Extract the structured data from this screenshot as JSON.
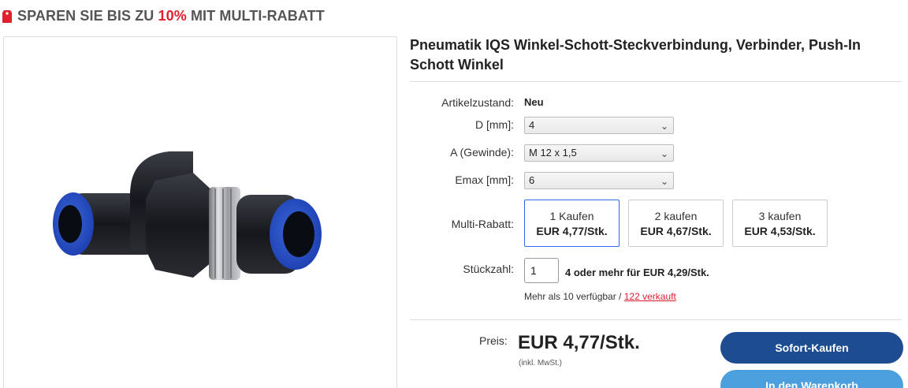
{
  "banner": {
    "prefix": "SPAREN SIE BIS ZU",
    "discount": "10%",
    "suffix": "MIT MULTI-RABATT",
    "icon": "price-tag-icon",
    "accent_color": "#e0212d"
  },
  "product": {
    "title": "Pneumatik IQS Winkel-Schott-Steckverbindung, Verbinder, Push-In Schott Winkel",
    "image_icon": "pneumatic-elbow-fitting-image"
  },
  "condition": {
    "label": "Artikelzustand:",
    "value": "Neu"
  },
  "options": [
    {
      "label": "D [mm]:",
      "value": "4"
    },
    {
      "label": "A (Gewinde):",
      "value": "M 12 x 1,5"
    },
    {
      "label": "Emax [mm]:",
      "value": "6"
    }
  ],
  "multi_rabatt": {
    "label": "Multi-Rabatt:",
    "tiers": [
      {
        "qty": "1 Kaufen",
        "price": "EUR 4,77/Stk.",
        "selected": true
      },
      {
        "qty": "2 kaufen",
        "price": "EUR 4,67/Stk.",
        "selected": false
      },
      {
        "qty": "3 kaufen",
        "price": "EUR 4,53/Stk.",
        "selected": false
      }
    ]
  },
  "quantity": {
    "label": "Stückzahl:",
    "value": "1",
    "note": "4 oder mehr für EUR 4,29/Stk.",
    "availability": "Mehr als 10 verfügbar /",
    "sold": "122 verkauft"
  },
  "price": {
    "label": "Preis:",
    "value": "EUR 4,77/Stk.",
    "tax_note": "(inkl. MwSt.)"
  },
  "buttons": {
    "buy_now": "Sofort-Kaufen",
    "add_to_cart": "In den Warenkorb",
    "buy_color": "#1d4c91",
    "cart_color": "#4b9fdc"
  }
}
